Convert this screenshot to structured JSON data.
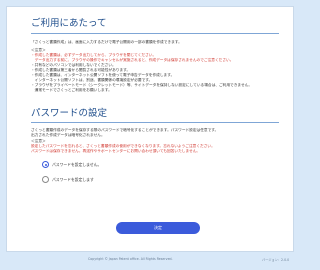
{
  "intro": {
    "title": "ご利用にあたって",
    "lead": "「さくっと書類作成」は、画面に入力するだけで電子公開用の一部の書類を作成できます。",
    "notice_head": "＜注意＞",
    "red_lines": [
      "・作成した書類は、必ずデータ出力してから、ブラウザを閉じてください。",
      "　データ出力する前に、ブラウザの操作でキャンセルが実施されると、作成データは保存されませんのでご注意ください。"
    ],
    "lines": [
      "・共有などのパソコンでは利用しないでください。",
      "・作成した書類は第三者から閲覧される可能性があります。",
      "・作成した書類は、インターネット公開ソフトを使って電子申告データを作成します。",
      "　インターネット公開ソフトは、別途、書類関係の環境設定が必要です。",
      "・ブラウザをプライベートモード（シークレットモード）等、サイトデータを保持しない設定にしている場合は、ご利用できません。",
      "　通常モードでさくっとご利用をお願いします。"
    ]
  },
  "password": {
    "title": "パスワードの設定",
    "lines": [
      "さくっと書類作成のデータを保存する際のパスワードで暗号化することができます。パスワード設定は任意です。",
      "出力された作成データは暗号化されません。"
    ],
    "notice_head": "＜注意＞",
    "red_lines": [
      "設定したパスワードを忘れると、さくっと書類作成の使用ができなくなります。忘れないようご注意ください。",
      "パスワードは保存できません。再送作やサポートセンターにお問い合わせ頂いても回答いたしません。"
    ],
    "options": [
      {
        "label": "パスワードを設定しません。",
        "selected": true
      },
      {
        "label": "パスワードを設定します",
        "selected": false
      }
    ]
  },
  "actions": {
    "decide_label": "決定"
  },
  "footer": {
    "copyright": "Copyright © Japan Patent office. All Rights Reserved.",
    "version": "バージョン：2.0.0"
  },
  "colors": {
    "accent": "#3b5bdb",
    "notice_red": "#d0342c",
    "title_blue": "#1f4e8c",
    "background": "#d8e8f8"
  }
}
